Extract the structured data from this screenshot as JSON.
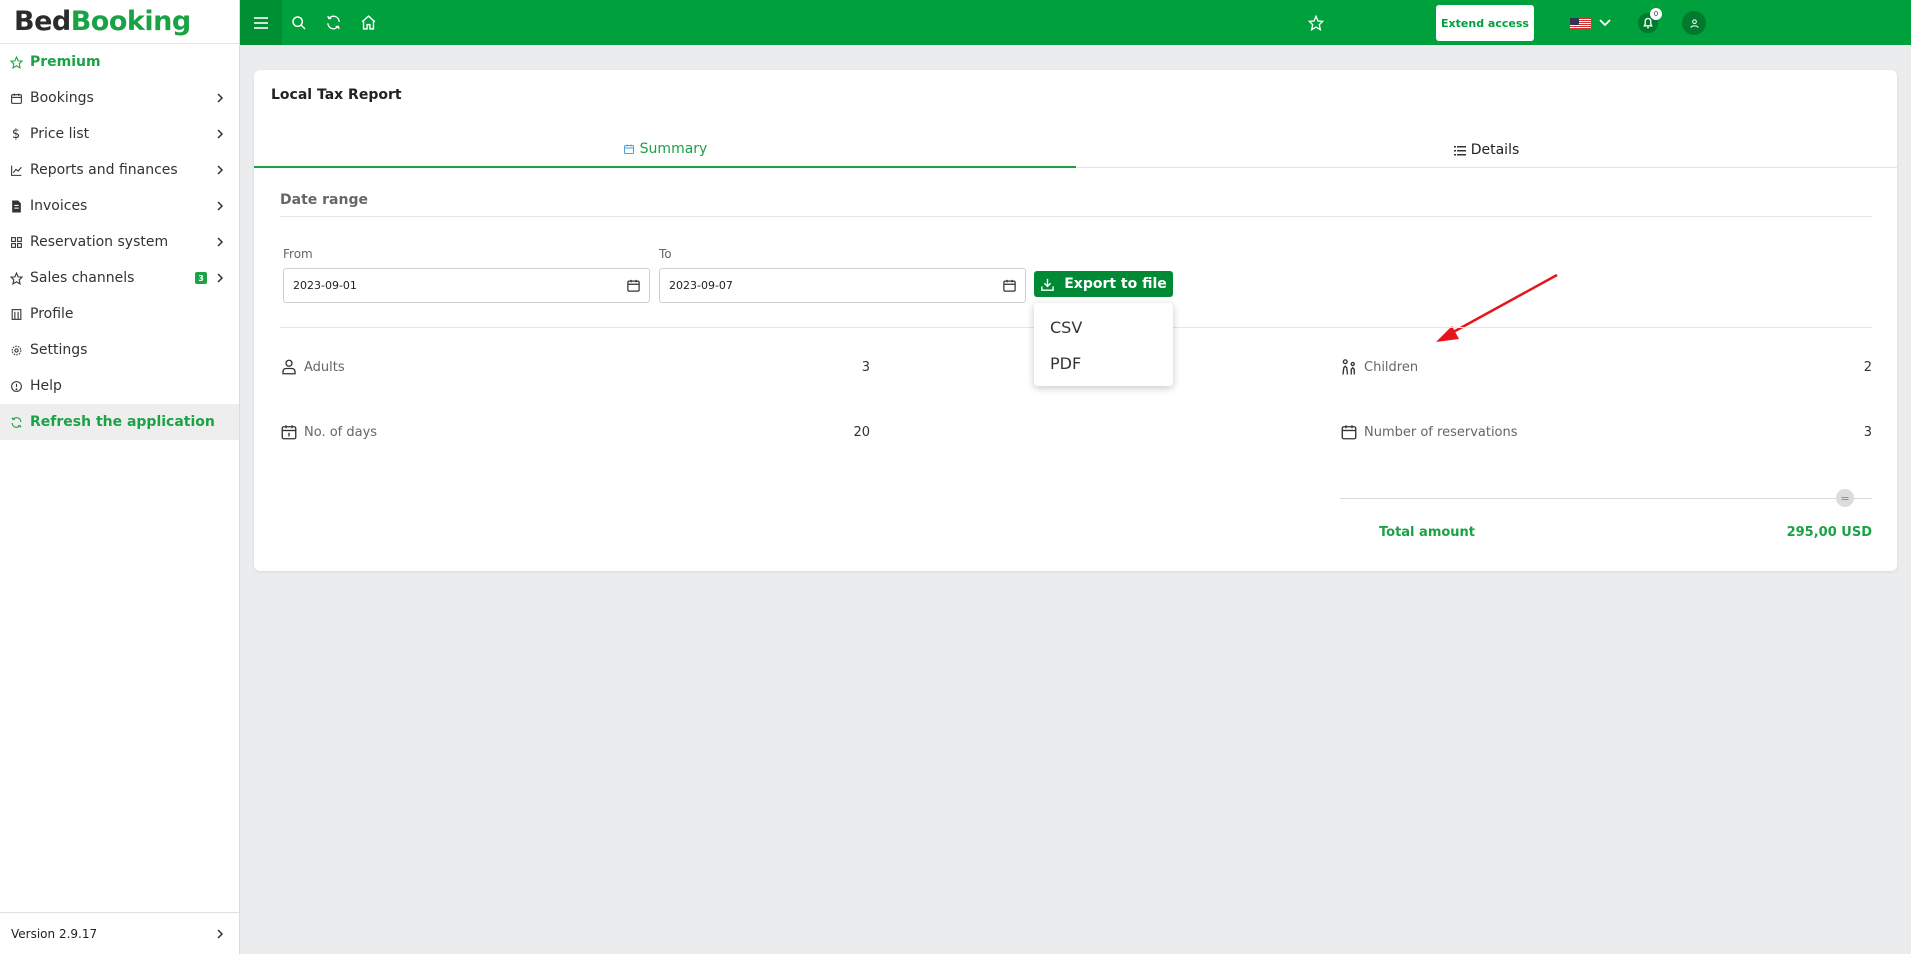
{
  "brand": {
    "part1": "Bed",
    "part2": "Booking"
  },
  "sidebar": {
    "items": [
      {
        "label": "Premium",
        "icon": "star-icon"
      },
      {
        "label": "Bookings",
        "icon": "calendar-icon"
      },
      {
        "label": "Price list",
        "icon": "dollar-icon"
      },
      {
        "label": "Reports and finances",
        "icon": "chart-line-icon"
      },
      {
        "label": "Invoices",
        "icon": "invoice-icon"
      },
      {
        "label": "Reservation system",
        "icon": "grid-icon"
      },
      {
        "label": "Sales channels",
        "icon": "star-icon",
        "badge": "3"
      },
      {
        "label": "Profile",
        "icon": "building-icon"
      },
      {
        "label": "Settings",
        "icon": "gear-icon"
      },
      {
        "label": "Help",
        "icon": "info-icon"
      },
      {
        "label": "Refresh the application",
        "icon": "refresh-icon"
      }
    ],
    "version": "Version 2.9.17"
  },
  "topbar": {
    "extend_label": "Extend access",
    "notification_count": "0",
    "language": "en-US flag"
  },
  "page": {
    "title": "Local Tax Report",
    "tabs": [
      {
        "label": "Summary",
        "active": true
      },
      {
        "label": "Details",
        "active": false
      }
    ],
    "date_range_label": "Date range",
    "from_label": "From",
    "from_value": "2023-09-01",
    "to_label": "To",
    "to_value": "2023-09-07",
    "export_label": "Export to file",
    "export_options": [
      "CSV",
      "PDF"
    ]
  },
  "stats": {
    "adults_label": "Adults",
    "adults_value": "3",
    "children_label": "Children",
    "children_value": "2",
    "days_label": "No. of days",
    "days_value": "20",
    "reservations_label": "Number of reservations",
    "reservations_value": "3",
    "equals_symbol": "=",
    "total_label": "Total amount",
    "total_value": "295,00 USD"
  },
  "colors": {
    "brand_green": "#00a03c",
    "accent_green": "#1aa344",
    "annotation_red": "#e8141b"
  }
}
